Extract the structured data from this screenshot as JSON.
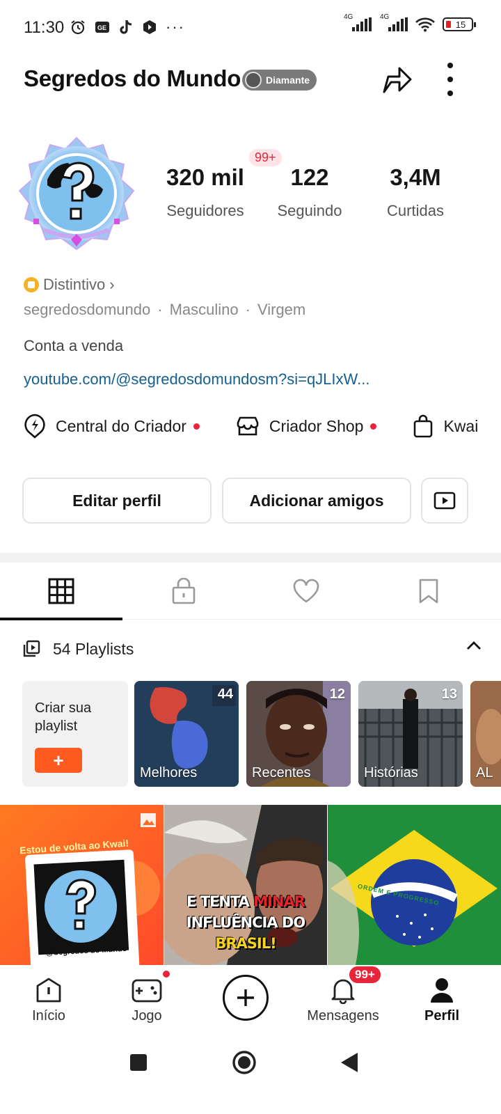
{
  "status_bar": {
    "time": "11:30",
    "network_1": "4G",
    "network_2": "4G",
    "battery": "15"
  },
  "header": {
    "username": "Segredos do Mundo",
    "tier_badge": "Diamante"
  },
  "profile": {
    "notif_pill": "99+",
    "stats": [
      {
        "value": "320 mil",
        "label": "Seguidores"
      },
      {
        "value": "122",
        "label": "Seguindo"
      },
      {
        "value": "3,4M",
        "label": "Curtidas"
      }
    ],
    "distintivo": "Distintivo",
    "meta": [
      "segredosdomundo",
      "·",
      "Masculino",
      "·",
      "Virgem"
    ],
    "bio": "Conta a venda",
    "link": "youtube.com/@segredosdomundosm?si=qJLIxW..."
  },
  "shortcuts": [
    {
      "label": "Central do Criador",
      "icon": "lightning-pin-icon",
      "dot": true
    },
    {
      "label": "Criador Shop",
      "icon": "shop-icon",
      "dot": true
    },
    {
      "label": "Kwai",
      "icon": "bag-icon",
      "dot": false
    }
  ],
  "actions": {
    "edit": "Editar perfil",
    "add_friends": "Adicionar amigos"
  },
  "playlists": {
    "header": "54 Playlists",
    "create_label": "Criar sua playlist",
    "create_button": "+",
    "items": [
      {
        "name": "Melhores",
        "count": "44"
      },
      {
        "name": "Recentes",
        "count": "12"
      },
      {
        "name": "Histórias",
        "count": "13"
      },
      {
        "name": "AL",
        "count": ""
      }
    ]
  },
  "feed": {
    "item1_caption": "Estou de volta ao Kwai!",
    "item1_handle": "@Segredos do Mundo",
    "item2_line1a": "E TENTA ",
    "item2_line1b": "MINAR",
    "item2_line2a": "INFLUÊNCIA DO ",
    "item2_line2b": "BRASIL!",
    "item3_band": "ORDEM E PROGRESSO"
  },
  "bottom_nav": [
    {
      "label": "Início",
      "icon": "home-icon"
    },
    {
      "label": "Jogo",
      "icon": "gamepad-icon"
    },
    {
      "label": "",
      "icon": "create-plus-icon"
    },
    {
      "label": "Mensagens",
      "icon": "bell-icon",
      "badge": "99+"
    },
    {
      "label": "Perfil",
      "icon": "person-icon"
    }
  ],
  "colors": {
    "accent": "#ff5a1f",
    "red": "#e8243b",
    "link": "#15608f"
  }
}
